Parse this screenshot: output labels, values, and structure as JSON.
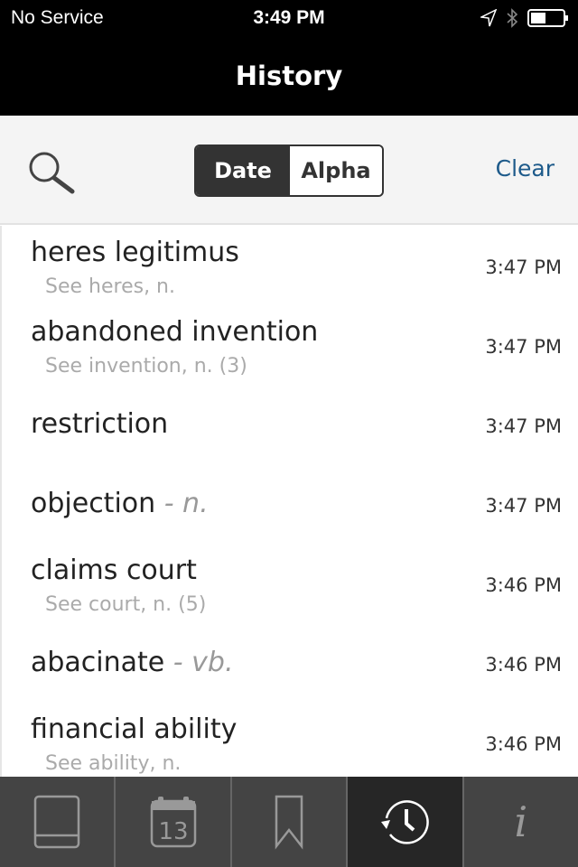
{
  "status": {
    "carrier": "No Service",
    "time": "3:49 PM"
  },
  "nav": {
    "title": "History"
  },
  "toolbar": {
    "segments": [
      "Date",
      "Alpha"
    ],
    "selected": "Date",
    "clear_label": "Clear",
    "accent": "#1d5a8a"
  },
  "entries": [
    {
      "term": "heres legitimus",
      "pos": "",
      "sub": "See heres, n.",
      "time": "3:47 PM"
    },
    {
      "term": "abandoned invention",
      "pos": "",
      "sub": "See invention, n. (3)",
      "time": "3:47 PM"
    },
    {
      "term": "restriction",
      "pos": "",
      "sub": "",
      "time": "3:47 PM"
    },
    {
      "term": "objection",
      "pos": " - n.",
      "sub": "",
      "time": "3:47 PM"
    },
    {
      "term": "claims court",
      "pos": "",
      "sub": "See court, n. (5)",
      "time": "3:46 PM"
    },
    {
      "term": "abacinate",
      "pos": " - vb.",
      "sub": "",
      "time": "3:46 PM"
    },
    {
      "term": "financial ability",
      "pos": "",
      "sub": "See ability, n.",
      "time": "3:46 PM"
    }
  ],
  "tabbar": {
    "tabs": [
      {
        "icon": "book-icon"
      },
      {
        "icon": "calendar-icon",
        "label": "13"
      },
      {
        "icon": "bookmark-icon"
      },
      {
        "icon": "history-icon",
        "active": true
      },
      {
        "icon": "info-icon",
        "label": "i"
      }
    ]
  }
}
